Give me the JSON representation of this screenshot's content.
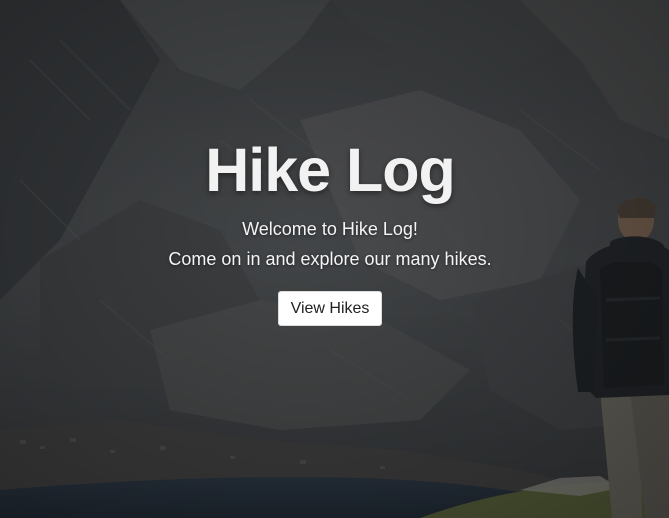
{
  "hero": {
    "title": "Hike Log",
    "welcome": "Welcome to Hike Log!",
    "tagline": "Come on in and explore our many hikes.",
    "button_label": "View Hikes"
  },
  "colors": {
    "overlay": "#2c2e30",
    "button_bg": "#ffffff",
    "button_text": "#222222",
    "heading_text": "#f2f2f2"
  },
  "background": {
    "subject": "mountain-lake-hiker-photo"
  }
}
